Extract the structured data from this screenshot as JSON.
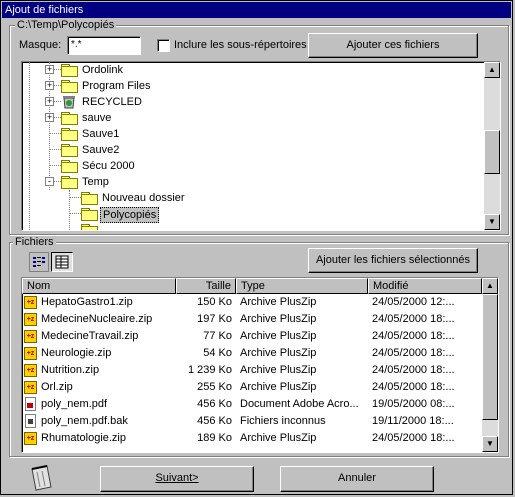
{
  "window": {
    "title": "Ajout de fichiers"
  },
  "source": {
    "path": "C:\\Temp\\Polycopiés",
    "mask_label": "Masque:",
    "mask_value": "*.*",
    "include_subdirs_label": "Inclure les sous-répertoires",
    "include_subdirs_checked": false,
    "add_these_files_label": "Ajouter ces fichiers"
  },
  "tree": {
    "items": [
      {
        "label": "Ordolink",
        "expander": "+"
      },
      {
        "label": "Program Files",
        "expander": "+"
      },
      {
        "label": "RECYCLED",
        "expander": "+",
        "icon": "recycle-bin-icon"
      },
      {
        "label": "sauve",
        "expander": "+"
      },
      {
        "label": "Sauve1",
        "expander": ""
      },
      {
        "label": "Sauve2",
        "expander": ""
      },
      {
        "label": "Sécu 2000",
        "expander": ""
      },
      {
        "label": "Temp",
        "expander": "-"
      },
      {
        "label": "Nouveau dossier",
        "expander": ""
      },
      {
        "label": "Polycopiés",
        "expander": "",
        "selected": true
      }
    ]
  },
  "files": {
    "group_label": "Fichiers",
    "add_selected_label": "Ajouter les fichiers sélectionnés",
    "columns": [
      "Nom",
      "Taille",
      "Type",
      "Modifié"
    ],
    "rows": [
      {
        "icon": "zip",
        "name": "HepatoGastro1.zip",
        "size": "150 Ko",
        "type": "Archive PlusZip",
        "modified": "24/05/2000 12:..."
      },
      {
        "icon": "zip",
        "name": "MedecineNucleaire.zip",
        "size": "197 Ko",
        "type": "Archive PlusZip",
        "modified": "24/05/2000 18:..."
      },
      {
        "icon": "zip",
        "name": "MedecineTravail.zip",
        "size": "77 Ko",
        "type": "Archive PlusZip",
        "modified": "24/05/2000 18:..."
      },
      {
        "icon": "zip",
        "name": "Neurologie.zip",
        "size": "54 Ko",
        "type": "Archive PlusZip",
        "modified": "24/05/2000 18:..."
      },
      {
        "icon": "zip",
        "name": "Nutrition.zip",
        "size": "1 239 Ko",
        "type": "Archive PlusZip",
        "modified": "24/05/2000 18:..."
      },
      {
        "icon": "zip",
        "name": "Orl.zip",
        "size": "255 Ko",
        "type": "Archive PlusZip",
        "modified": "24/05/2000 18:..."
      },
      {
        "icon": "pdf",
        "name": "poly_nem.pdf",
        "size": "456 Ko",
        "type": "Document Adobe Acro...",
        "modified": "19/05/2000 08:..."
      },
      {
        "icon": "bak",
        "name": "poly_nem.pdf.bak",
        "size": "456 Ko",
        "type": "Fichiers inconnus",
        "modified": "19/11/2000 18:..."
      },
      {
        "icon": "zip",
        "name": "Rhumatologie.zip",
        "size": "189 Ko",
        "type": "Archive PlusZip",
        "modified": "24/05/2000 18:..."
      }
    ]
  },
  "footer": {
    "next_label": "Suivant>",
    "cancel_label": "Annuler"
  },
  "colors": {
    "titlebar": "#000080",
    "selection": "#000080",
    "face": "#c0c0c0"
  }
}
